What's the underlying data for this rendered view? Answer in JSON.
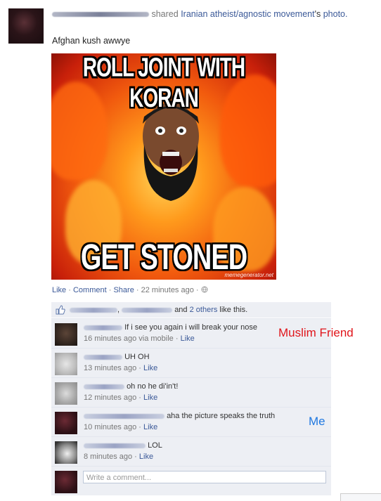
{
  "story": {
    "shared_word": "shared",
    "page_name": "Iranian atheist/agnostic movement",
    "possessive": "'s",
    "photo_link": "photo.",
    "caption": "Afghan kush awwye"
  },
  "meme": {
    "top_text": "ROLL JOINT WITH KORAN",
    "bottom_text": "GET STONED",
    "watermark": "memegenerator.net"
  },
  "actions": {
    "like": "Like",
    "comment": "Comment",
    "share": "Share",
    "time": "22 minutes ago",
    "sep": "·"
  },
  "likes": {
    "and": "and",
    "others": "2 others",
    "suffix": "like this."
  },
  "comments": [
    {
      "text": "If i see you again i will break your nose",
      "time": "16 minutes ago via mobile",
      "like": "Like"
    },
    {
      "text": "UH OH",
      "time": "13 minutes ago",
      "like": "Like"
    },
    {
      "text": "oh no he di'in't!",
      "time": "12 minutes ago",
      "like": "Like"
    },
    {
      "text": "aha the picture speaks the truth",
      "time": "10 minutes ago",
      "like": "Like"
    },
    {
      "text": "LOL",
      "time": "8 minutes ago",
      "like": "Like"
    }
  ],
  "annotations": {
    "muslim_friend": "Muslim Friend",
    "me": "Me"
  },
  "composer": {
    "placeholder": "Write a comment..."
  },
  "colors": {
    "link": "#3b5998",
    "ufi_bg": "#edeff4",
    "annotation_red": "#e0151b",
    "annotation_blue": "#1f78e0"
  }
}
